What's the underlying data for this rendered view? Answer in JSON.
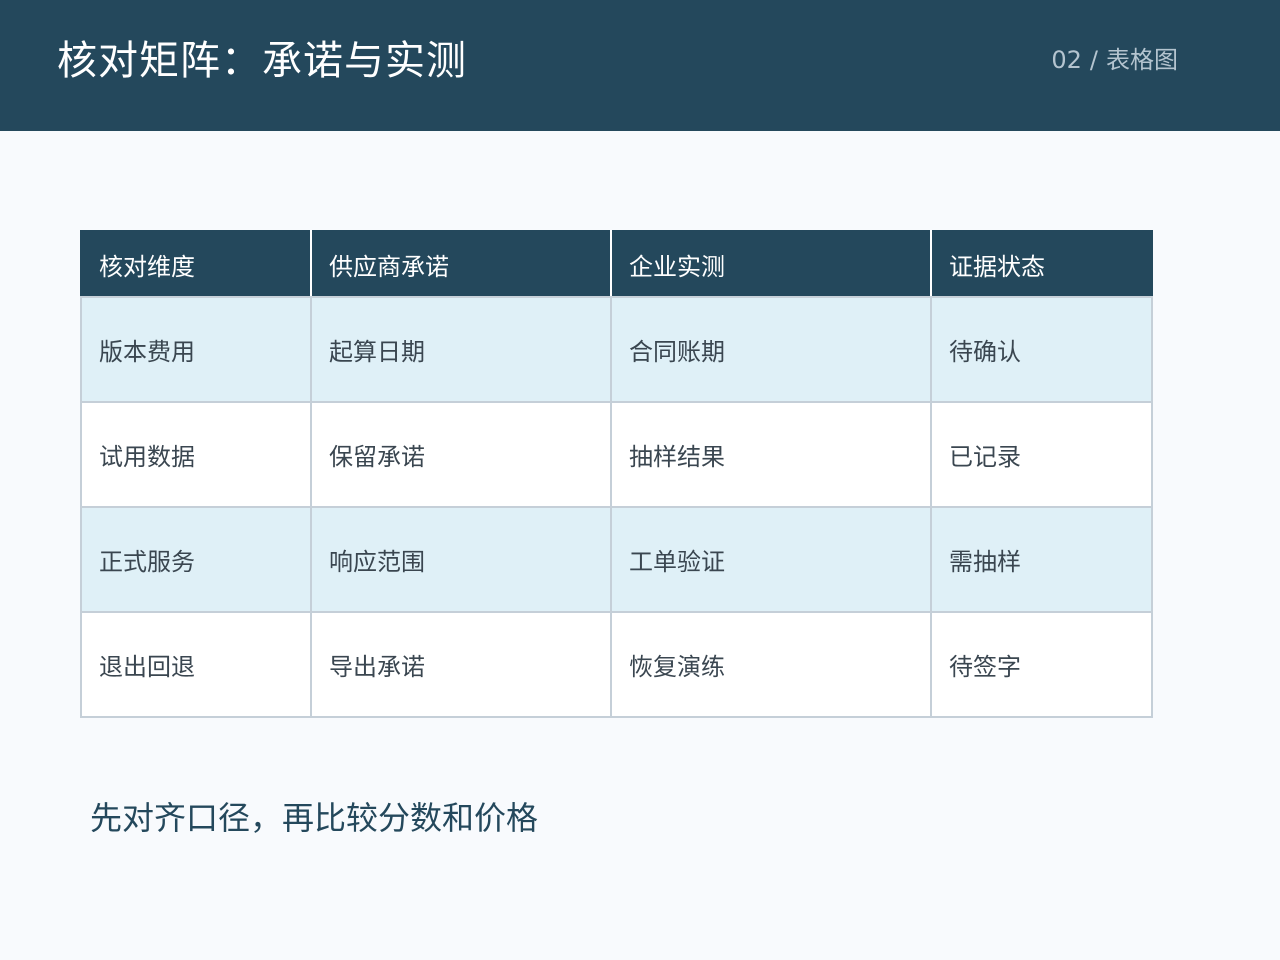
{
  "header": {
    "title": "核对矩阵：承诺与实测",
    "page_number": "02",
    "separator": "/",
    "section": "表格图"
  },
  "table": {
    "columns": [
      "核对维度",
      "供应商承诺",
      "企业实测",
      "证据状态"
    ],
    "rows": [
      [
        "版本费用",
        "起算日期",
        "合同账期",
        "待确认"
      ],
      [
        "试用数据",
        "保留承诺",
        "抽样结果",
        "已记录"
      ],
      [
        "正式服务",
        "响应范围",
        "工单验证",
        "需抽样"
      ],
      [
        "退出回退",
        "导出承诺",
        "恢复演练",
        "待签字"
      ]
    ]
  },
  "footer": {
    "note": "先对齐口径，再比较分数和价格"
  },
  "colors": {
    "header_bg": "#24485c",
    "row_shaded": "#dff0f7",
    "row_plain": "#ffffff",
    "page_bg": "#f8fafd"
  }
}
